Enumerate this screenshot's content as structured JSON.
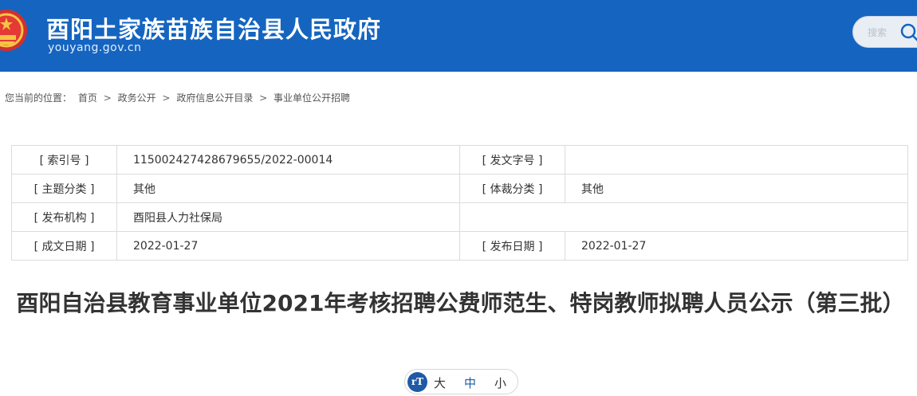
{
  "header": {
    "title": "酉阳土家族苗族自治县人民政府",
    "url": "youyang.gov.cn",
    "search_placeholder": "搜索",
    "brand_color": "#1565c0"
  },
  "breadcrumb": {
    "prefix": "您当前的位置：",
    "items": [
      "首页",
      "政务公开",
      "政府信息公开目录",
      "事业单位公开招聘"
    ],
    "separator": ">"
  },
  "meta": {
    "index_label": "[ 索引号 ]",
    "index_value": "115002427428679655/2022-00014",
    "doc_no_label": "[ 发文字号 ]",
    "doc_no_value": "",
    "topic_label": "[ 主题分类 ]",
    "topic_value": "其他",
    "genre_label": "[ 体裁分类 ]",
    "genre_value": "其他",
    "publisher_label": "[ 发布机构 ]",
    "publisher_value": "酉阳县人力社保局",
    "created_label": "[ 成文日期 ]",
    "created_value": "2022-01-27",
    "published_label": "[ 发布日期 ]",
    "published_value": "2022-01-27"
  },
  "article": {
    "title": "酉阳自治县教育事业单位2021年考核招聘公费师范生、特岗教师拟聘人员公示（第三批）"
  },
  "font_size": {
    "icon_text": "rT",
    "large": "大",
    "medium": "中",
    "small": "小",
    "selected": "medium"
  }
}
